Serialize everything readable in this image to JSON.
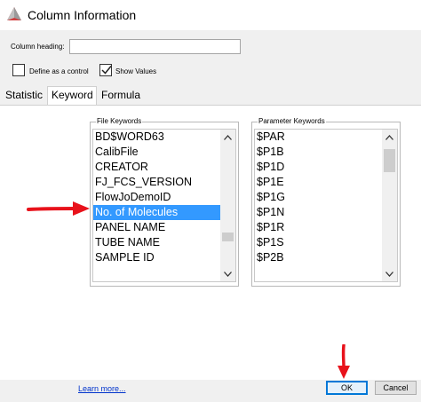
{
  "window": {
    "title": "Column Information"
  },
  "heading": {
    "label": "Column heading:",
    "value": ""
  },
  "checkboxes": [
    {
      "label": "Define as a control",
      "checked": false
    },
    {
      "label": "Show Values",
      "checked": true
    }
  ],
  "tabs": [
    {
      "label": "Statistic",
      "active": false
    },
    {
      "label": "Keyword",
      "active": true
    },
    {
      "label": "Formula",
      "active": false
    }
  ],
  "file_keywords": {
    "title": "File Keywords",
    "items": [
      "BD$WORD63",
      "CalibFile",
      "CREATOR",
      "FJ_FCS_VERSION",
      "FlowJoDemoID",
      "No. of Molecules",
      "PANEL NAME",
      "TUBE NAME",
      "SAMPLE ID"
    ],
    "selected": "No. of Molecules"
  },
  "parameter_keywords": {
    "title": "Parameter Keywords",
    "items": [
      "$PAR",
      "$P1B",
      "$P1D",
      "$P1E",
      "$P1G",
      "$P1N",
      "$P1R",
      "$P1S",
      "$P2B"
    ]
  },
  "footer": {
    "learn_more": "Learn more...",
    "ok": "OK",
    "cancel": "Cancel"
  },
  "colors": {
    "selection": "#3399ff",
    "annotation_arrow": "#e8121b",
    "link": "#0033cc"
  },
  "icons": [
    "app-icon",
    "check-icon",
    "scroll-up-icon",
    "scroll-down-icon",
    "annotation-arrow"
  ]
}
